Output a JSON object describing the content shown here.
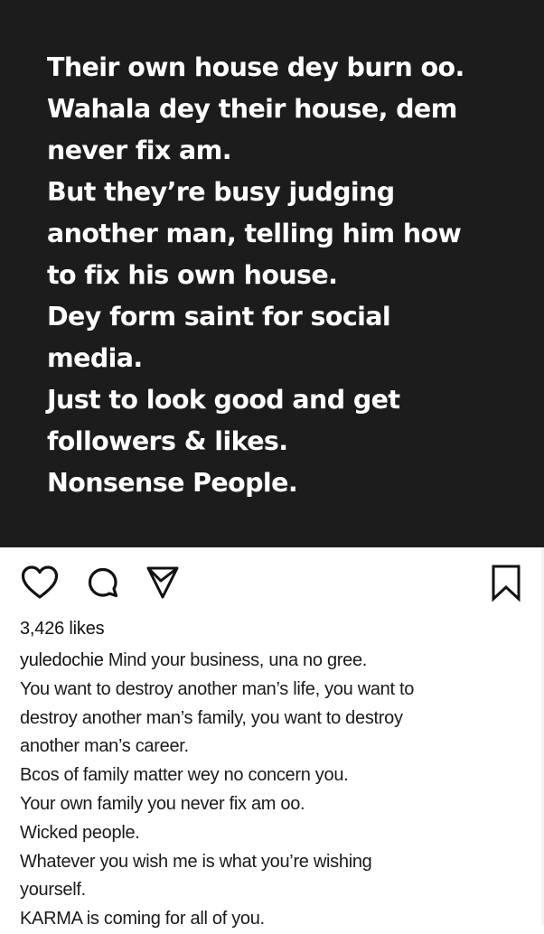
{
  "post": {
    "image_text_lines": [
      "Their own house dey burn oo.",
      "Wahala dey their house, dem",
      "never fix am.",
      "But they’re busy judging",
      "another man, telling him how",
      "to fix his own house.",
      "Dey form saint for social",
      "media.",
      "Just to look good and get",
      "followers & likes.",
      "Nonsense People."
    ],
    "image_background": "#1c1c1c"
  },
  "actions": {
    "like_icon": "heart-icon",
    "comment_icon": "comment-icon",
    "share_icon": "paper-plane-icon",
    "save_icon": "bookmark-icon"
  },
  "likes": "3,426 likes",
  "caption": {
    "username": "yuledochie",
    "first_line_text": " Mind your business, una no gree.",
    "lines": [
      "You want to destroy another man’s life, you want to",
      "destroy another man’s family, you want to destroy",
      "another man’s career.",
      "Bcos of family matter wey no concern you.",
      "Your own family you never fix am oo.",
      "Wicked people.",
      "Whatever you wish me is what you’re wishing",
      "yourself.",
      "KARMA is coming for all of you."
    ]
  }
}
